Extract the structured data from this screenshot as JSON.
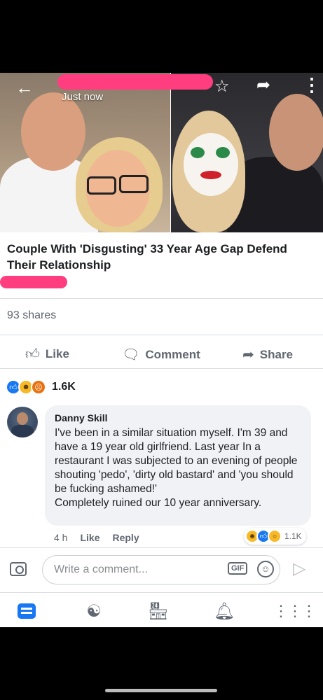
{
  "header": {
    "timestamp": "Just now",
    "icons": {
      "back": "back-arrow-icon",
      "star": "star-icon",
      "share": "share-arrow-icon",
      "more": "more-vertical-icon"
    }
  },
  "post": {
    "headline": "Couple With 'Disgusting' 33 Year Age Gap Defend Their Relationship",
    "shares": "93 shares"
  },
  "actions": {
    "like": "Like",
    "comment": "Comment",
    "share": "Share"
  },
  "reactions": {
    "count": "1.6K"
  },
  "comment": {
    "author": "Danny Skill",
    "text": "I've been in a similar situation  myself. I'm 39 and have a 19 year old girlfriend. Last year In a restaurant I was subjected to an evening of people shouting 'pedo', 'dirty old bastard' and 'you should be fucking ashamed!'\nCompletely ruined our 10 year anniversary.",
    "time": "4 h",
    "like": "Like",
    "reply": "Reply",
    "reaction_count": "1.1K"
  },
  "composer": {
    "placeholder": "Write a comment..."
  },
  "colors": {
    "accent": "#1877f2",
    "redaction": "#ff3d7f"
  }
}
